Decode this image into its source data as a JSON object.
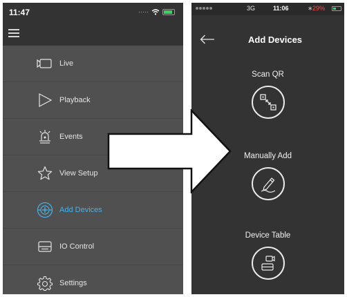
{
  "left_phone": {
    "status_time": "11:47",
    "menu": [
      {
        "label": "Live",
        "icon": "camera-icon",
        "active": false
      },
      {
        "label": "Playback",
        "icon": "play-icon",
        "active": false
      },
      {
        "label": "Events",
        "icon": "alarm-icon",
        "active": false
      },
      {
        "label": "View Setup",
        "icon": "star-icon",
        "active": false
      },
      {
        "label": "Add Devices",
        "icon": "add-device-icon",
        "active": true
      },
      {
        "label": "IO Control",
        "icon": "io-control-icon",
        "active": false
      },
      {
        "label": "Settings",
        "icon": "gear-icon",
        "active": false
      }
    ]
  },
  "right_phone": {
    "status_network": "3G",
    "status_time": "11:06",
    "status_battery": "29%",
    "title": "Add Devices",
    "actions": [
      {
        "label": "Scan QR",
        "icon": "qr-scan-icon"
      },
      {
        "label": "Manually Add",
        "icon": "pencil-icon"
      },
      {
        "label": "Device Table",
        "icon": "device-table-icon"
      }
    ]
  },
  "colors": {
    "menu_bg": "#505050",
    "header_bg": "#333333",
    "active_accent": "#4ab0e6",
    "right_bg": "#333333"
  }
}
